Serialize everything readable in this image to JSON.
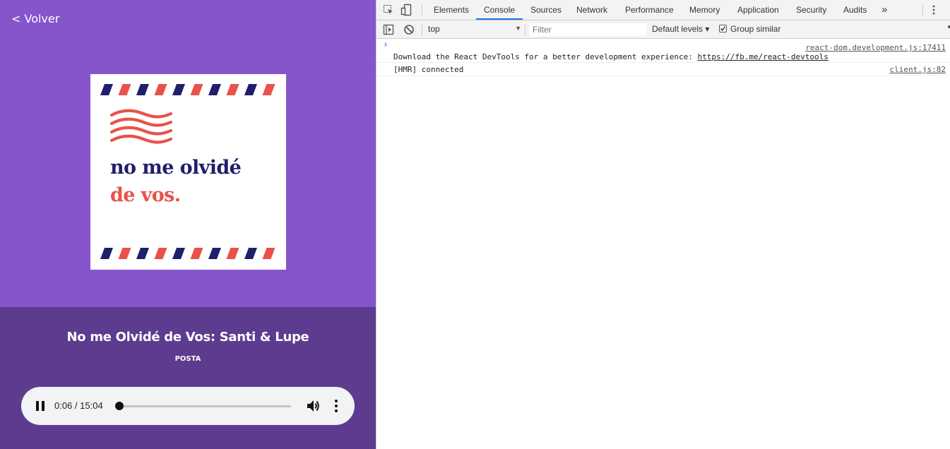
{
  "app": {
    "back_label": "< Volver",
    "cover": {
      "line1": "no me olvidé",
      "line2": "de vos."
    },
    "title": "No me Olvidé de Vos: Santi & Lupe",
    "subtitle": "POSTA",
    "player": {
      "time": "0:06 / 15:04",
      "progress_fraction": 0.0066
    },
    "colors": {
      "top_bg": "#8655cb",
      "bottom_bg": "#5d3c8f",
      "cover_navy": "#1f1f6b",
      "cover_red": "#e8524a"
    }
  },
  "devtools": {
    "tabs": [
      {
        "label": "Elements"
      },
      {
        "label": "Console",
        "active": true
      },
      {
        "label": "Sources"
      },
      {
        "label": "Network"
      },
      {
        "label": "Performance"
      },
      {
        "label": "Memory"
      },
      {
        "label": "Application"
      },
      {
        "label": "Security"
      },
      {
        "label": "Audits"
      }
    ],
    "overflow_label": "»",
    "toolbar": {
      "context": "top",
      "filter_placeholder": "Filter",
      "levels": "Default levels ▾",
      "group_similar": "Group similar",
      "group_similar_checked": true
    },
    "messages": [
      {
        "source": "react-dom.development.js:17411",
        "text": "Download the React DevTools for a better development experience: ",
        "link": "https://fb.me/react-devtools"
      },
      {
        "source": "client.js:82",
        "text": "[HMR] connected"
      }
    ],
    "prompt": "›"
  }
}
